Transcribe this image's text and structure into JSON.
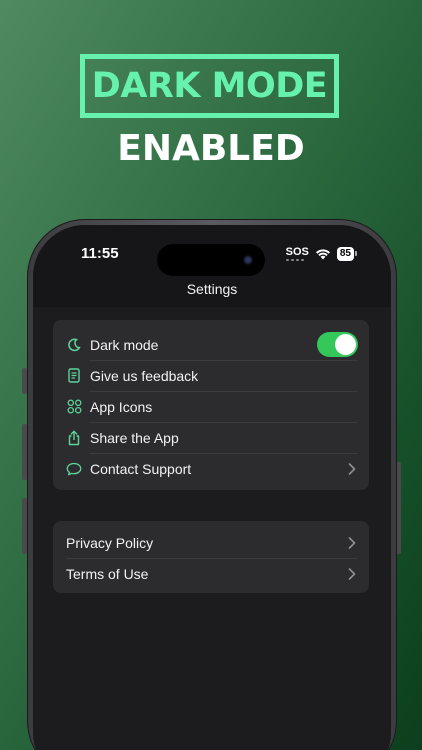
{
  "hero": {
    "title": "DARK MODE",
    "subtitle": "ENABLED"
  },
  "status_bar": {
    "time": "11:55",
    "sos": "SOS",
    "battery": "85"
  },
  "nav": {
    "title": "Settings"
  },
  "group1": [
    {
      "label": "Dark mode",
      "icon": "moon-icon",
      "control": "toggle",
      "toggle_on": true
    },
    {
      "label": "Give us feedback",
      "icon": "document-icon"
    },
    {
      "label": "App Icons",
      "icon": "grid-icon"
    },
    {
      "label": "Share the App",
      "icon": "share-icon"
    },
    {
      "label": "Contact Support",
      "icon": "chat-bubble-icon",
      "control": "chevron"
    }
  ],
  "group2": [
    {
      "label": "Privacy Policy",
      "control": "chevron"
    },
    {
      "label": "Terms of Use",
      "control": "chevron"
    }
  ],
  "colors": {
    "accent": "#66f2ae",
    "toggle_on": "#34c759",
    "icon_green": "#5ed39a",
    "screen_bg": "#1c1c1e",
    "cell_bg": "#2c2c2e"
  }
}
